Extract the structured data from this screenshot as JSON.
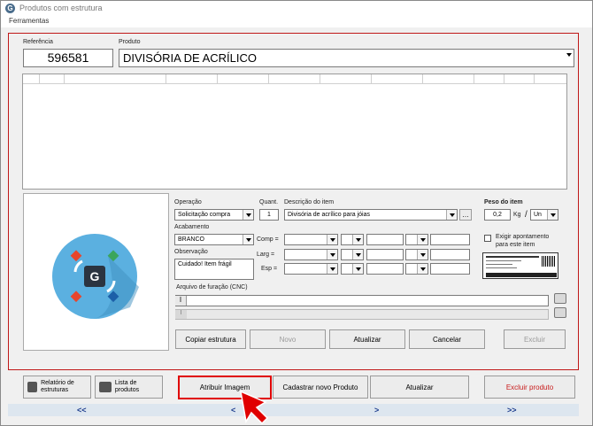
{
  "window": {
    "title": "Produtos com estrutura",
    "app_icon": "G"
  },
  "menu": {
    "tools": "Ferramentas"
  },
  "header": {
    "ref_label": "Referência",
    "ref_value": "596581",
    "product_label": "Produto",
    "product_value": "DIVISÓRIA DE ACRÍLICO"
  },
  "item": {
    "operation_label": "Operação",
    "operation_value": "Solicitação compra",
    "qty_label": "Quant.",
    "qty_value": "1",
    "desc_label": "Descrição do item",
    "desc_value": "Divisória de acrílico para jóias",
    "weight_label": "Peso do item",
    "weight_value": "0,2",
    "weight_unit": "Kg",
    "unit_value": "Un",
    "finish_label": "Acabamento",
    "finish_value": "BRANCO",
    "comp_label": "Comp =",
    "larg_label": "Larg =",
    "esp_label": "Esp =",
    "obs_label": "Observação",
    "obs_value": "Cuidado! Item frágil",
    "exigir_label": "Exigir apontamento para este item",
    "cnc_label": "Arquivo de furação (CNC)"
  },
  "item_buttons": {
    "copy": "Copiar estrutura",
    "new": "Novo",
    "update": "Atualizar",
    "cancel": "Cancelar",
    "delete": "Excluir"
  },
  "footer": {
    "report_structures": "Relatório de estruturas",
    "product_list": "Lista de produtos",
    "assign_image": "Atribuir Imagem",
    "register_new": "Cadastrar novo Produto",
    "update": "Atualizar",
    "delete_product": "Excluir produto"
  },
  "nav": {
    "first": "<<",
    "prev": "<",
    "next": ">",
    "last": ">>"
  },
  "colors": {
    "highlight": "#e00000",
    "accent": "#5bb0e0",
    "frame": "#c01818"
  }
}
